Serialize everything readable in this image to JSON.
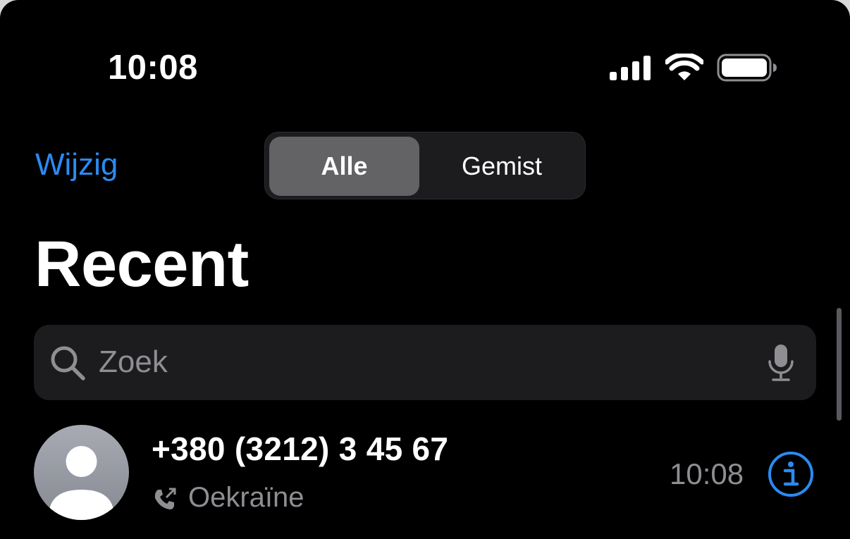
{
  "status_bar": {
    "time": "10:08",
    "icons": [
      "cellular-signal-icon",
      "wifi-icon",
      "battery-icon"
    ]
  },
  "nav": {
    "edit_label": "Wijzig",
    "segments": [
      {
        "label": "Alle",
        "selected": true
      },
      {
        "label": "Gemist",
        "selected": false
      }
    ]
  },
  "page_title": "Recent",
  "search": {
    "placeholder": "Zoek",
    "value": "",
    "icons": [
      "magnifier-icon",
      "microphone-icon"
    ]
  },
  "calls": [
    {
      "caller": "+380 (3212) 3 45 67",
      "location": "Oekraïne",
      "time": "10:08",
      "call_type_icon": "outgoing-call-icon"
    }
  ],
  "colors": {
    "accent": "#2a8bf2",
    "background": "#000000",
    "secondary_text": "#8e8e93",
    "field_background": "#1c1c1e",
    "segment_selected": "#636366"
  }
}
